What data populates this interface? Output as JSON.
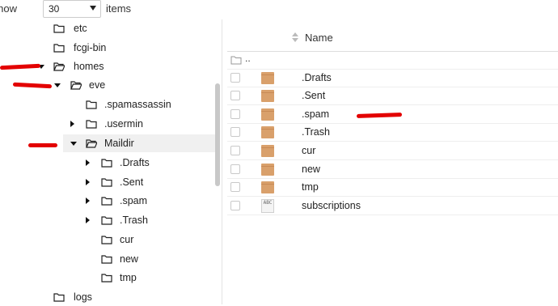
{
  "pager": {
    "show_label": "Show",
    "per_page": "30",
    "items_label": "items"
  },
  "tree": {
    "items": [
      {
        "label": "etc"
      },
      {
        "label": "fcgi-bin"
      },
      {
        "label": "homes"
      },
      {
        "label": "eve"
      },
      {
        "label": ".spamassassin"
      },
      {
        "label": ".usermin"
      },
      {
        "label": "Maildir"
      },
      {
        "label": ".Drafts"
      },
      {
        "label": ".Sent"
      },
      {
        "label": ".spam"
      },
      {
        "label": ".Trash"
      },
      {
        "label": "cur"
      },
      {
        "label": "new"
      },
      {
        "label": "tmp"
      },
      {
        "label": "logs"
      }
    ]
  },
  "files": {
    "column_name": "Name",
    "parent_label": "..",
    "rows": [
      {
        "name": ".Drafts",
        "icon": "folder-icon"
      },
      {
        "name": ".Sent",
        "icon": "folder-icon"
      },
      {
        "name": ".spam",
        "icon": "folder-icon"
      },
      {
        "name": ".Trash",
        "icon": "folder-icon"
      },
      {
        "name": "cur",
        "icon": "folder-icon"
      },
      {
        "name": "new",
        "icon": "folder-icon"
      },
      {
        "name": "tmp",
        "icon": "folder-icon"
      },
      {
        "name": "subscriptions",
        "icon": "text-file-icon"
      }
    ],
    "text_file_icon_label": "ABC"
  },
  "colors": {
    "annotation": "#e30000",
    "folder": "#d9a06b",
    "selected_row": "#f0f0f0"
  }
}
